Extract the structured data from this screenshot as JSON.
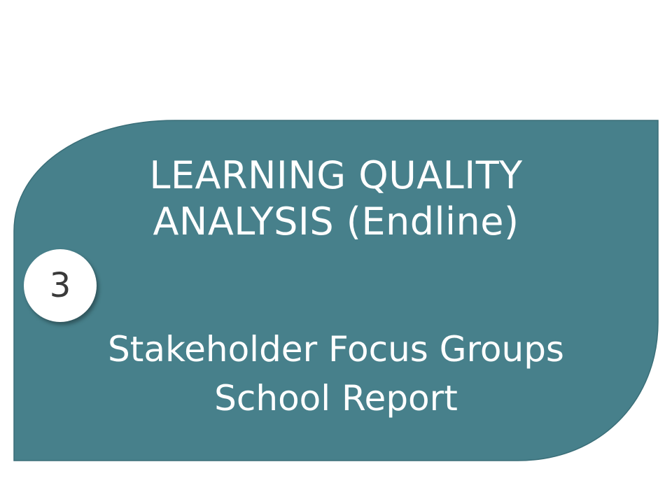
{
  "colors": {
    "banner": "#47808b",
    "banner_edge": "#3a6e78",
    "text": "#ffffff",
    "badge_background": "#ffffff",
    "badge_text": "#3a3a3a"
  },
  "title": {
    "line1": "LEARNING QUALITY",
    "line2": "ANALYSIS (Endline)"
  },
  "badge": {
    "number": "3"
  },
  "subtitle": {
    "line1": "Stakeholder Focus Groups",
    "line2": "School Report"
  }
}
